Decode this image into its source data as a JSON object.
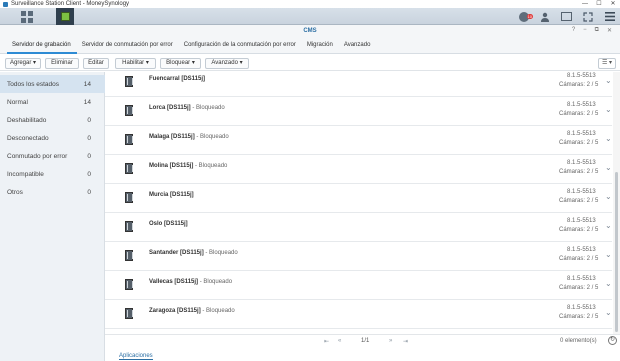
{
  "window": {
    "title": "Surveillance Station Client - MoneySynology",
    "minimize": "—",
    "maximize": "☐",
    "close": "✕"
  },
  "topbar": {
    "notif_badge": "10",
    "icons": [
      "grid-icon",
      "cms-icon",
      "notification-icon",
      "user-icon",
      "window-icon",
      "fullscreen-icon",
      "menu-icon"
    ]
  },
  "cms": {
    "title": "CMS",
    "help": "?",
    "minimize": "−",
    "restore": "⧉",
    "close": "✕"
  },
  "tabs": [
    {
      "label": "Servidor de grabación",
      "active": true
    },
    {
      "label": "Servidor de conmutación por error",
      "active": false
    },
    {
      "label": "Configuración de la conmutación por error",
      "active": false
    },
    {
      "label": "Migración",
      "active": false
    },
    {
      "label": "Avanzado",
      "active": false
    }
  ],
  "toolbar": {
    "add": "Agregar ▾",
    "delete": "Eliminar",
    "edit": "Editar",
    "enable": "Habilitar ▾",
    "lock": "Bloquear ▾",
    "advanced": "Avanzado ▾",
    "view": "☰ ▾"
  },
  "sidebar": [
    {
      "label": "Todos los estados",
      "count": "14",
      "active": true
    },
    {
      "label": "Normal",
      "count": "14",
      "active": false
    },
    {
      "label": "Deshabilitado",
      "count": "0",
      "active": false
    },
    {
      "label": "Desconectado",
      "count": "0",
      "active": false
    },
    {
      "label": "Conmutado por error",
      "count": "0",
      "active": false
    },
    {
      "label": "Incompatible",
      "count": "0",
      "active": false
    },
    {
      "label": "Otros",
      "count": "0",
      "active": false
    }
  ],
  "servers": [
    {
      "name": "Fuencarral [DS115j]",
      "status": "",
      "version": "8.1.5-5513",
      "cameras": "Cámaras: 2 / 5"
    },
    {
      "name": "Lorca [DS115j]",
      "status": " - Bloqueado",
      "version": "8.1.5-5513",
      "cameras": "Cámaras: 2 / 5"
    },
    {
      "name": "Malaga [DS115j]",
      "status": " - Bloqueado",
      "version": "8.1.5-5513",
      "cameras": "Cámaras: 2 / 5"
    },
    {
      "name": "Molina [DS115j]",
      "status": " - Bloqueado",
      "version": "8.1.5-5513",
      "cameras": "Cámaras: 2 / 5"
    },
    {
      "name": "Murcia [DS115j]",
      "status": "",
      "version": "8.1.5-5513",
      "cameras": "Cámaras: 2 / 5"
    },
    {
      "name": "Oslo [DS115j]",
      "status": "",
      "version": "8.1.5-5513",
      "cameras": "Cámaras: 2 / 5"
    },
    {
      "name": "Santander [DS115j]",
      "status": " - Bloqueado",
      "version": "8.1.5-5513",
      "cameras": "Cámaras: 2 / 5"
    },
    {
      "name": "Vallecas [DS115j]",
      "status": " - Bloqueado",
      "version": "8.1.5-5513",
      "cameras": "Cámaras: 2 / 5"
    },
    {
      "name": "Zaragoza [DS115j]",
      "status": " - Bloqueado",
      "version": "8.1.5-5513",
      "cameras": "Cámaras: 2 / 5"
    }
  ],
  "pager": {
    "first": "⇤",
    "prev": "«",
    "page": "1/1",
    "next": "»",
    "last": "⇥",
    "elements": "0 elemento(s)",
    "refresh": "↻"
  },
  "bottom": {
    "tab": "Aplicaciones"
  }
}
